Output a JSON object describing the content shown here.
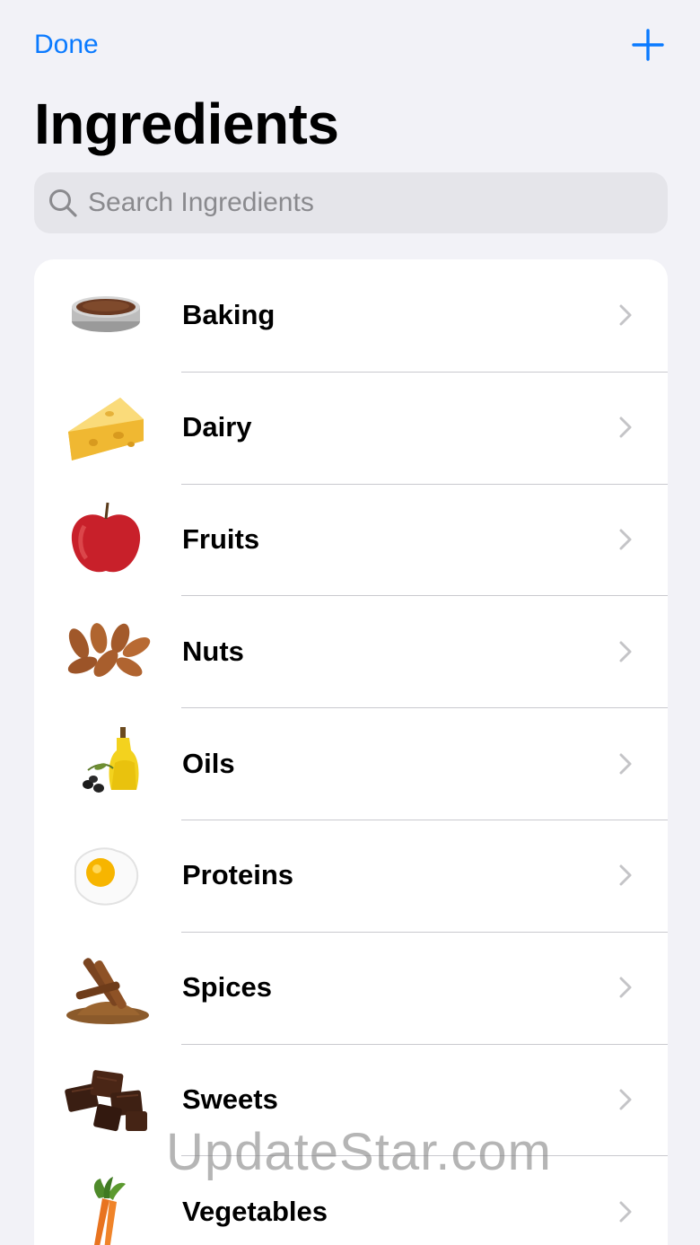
{
  "nav": {
    "done_label": "Done",
    "add_icon": "plus-icon"
  },
  "page": {
    "title": "Ingredients"
  },
  "search": {
    "placeholder": "Search Ingredients",
    "value": ""
  },
  "categories": [
    {
      "label": "Baking",
      "icon": "cake-pan-icon"
    },
    {
      "label": "Dairy",
      "icon": "cheese-icon"
    },
    {
      "label": "Fruits",
      "icon": "apple-icon"
    },
    {
      "label": "Nuts",
      "icon": "almonds-icon"
    },
    {
      "label": "Oils",
      "icon": "olive-oil-icon"
    },
    {
      "label": "Proteins",
      "icon": "egg-icon"
    },
    {
      "label": "Spices",
      "icon": "cinnamon-icon"
    },
    {
      "label": "Sweets",
      "icon": "chocolate-icon"
    },
    {
      "label": "Vegetables",
      "icon": "carrot-icon"
    }
  ],
  "watermark": "UpdateStar.com",
  "colors": {
    "accent": "#0A7AFF",
    "background": "#F2F2F7",
    "card": "#FFFFFF",
    "search_bg": "#E5E5EA"
  }
}
